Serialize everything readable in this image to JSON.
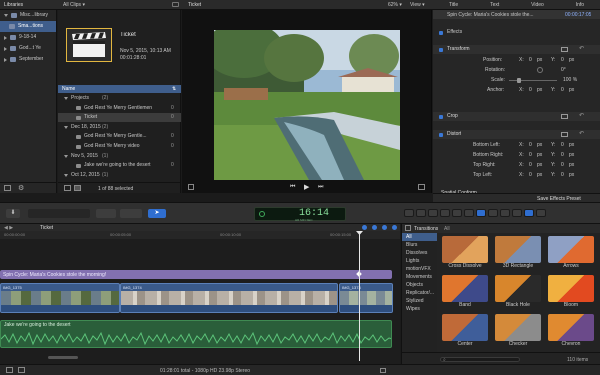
{
  "topbar": {
    "libraries": "Libraries",
    "all_clips": "All Clips ▾",
    "viewer_title": "Ticket",
    "zoom": "62% ▾",
    "view": "View ▾"
  },
  "library": {
    "items": [
      {
        "label": "Misc...library",
        "open": true,
        "sel": false
      },
      {
        "label": "Sma...tions",
        "open": false,
        "sel": true
      },
      {
        "label": "9-18-14",
        "open": false,
        "sel": false
      },
      {
        "label": "God...t Ye",
        "open": false,
        "sel": false
      },
      {
        "label": "September",
        "open": false,
        "sel": false
      }
    ]
  },
  "browser": {
    "clip_name": "Ticket",
    "clip_date": "Nov 5, 2015, 10:13 AM",
    "clip_duration": "00:01:28:01",
    "name_col": "Name",
    "rows": [
      {
        "indent": 1,
        "label": "Projects",
        "count": "(2)",
        "tri": "open",
        "sel": false
      },
      {
        "indent": 2,
        "label": "God Rest Ye Merry Gentlemen",
        "count": "0",
        "tri": "",
        "sel": false
      },
      {
        "indent": 2,
        "label": "Ticket",
        "count": "0",
        "tri": "",
        "sel": true
      },
      {
        "indent": 1,
        "label": "Dec 18, 2015",
        "count": "(2)",
        "tri": "open",
        "sel": false
      },
      {
        "indent": 2,
        "label": "God Rest Ye Merry Gentle...",
        "count": "0",
        "tri": "",
        "sel": false
      },
      {
        "indent": 2,
        "label": "God Rest Ye Merry video",
        "count": "0",
        "tri": "",
        "sel": false
      },
      {
        "indent": 1,
        "label": "Nov 5, 2015",
        "count": "(1)",
        "tri": "open",
        "sel": false
      },
      {
        "indent": 2,
        "label": "Jake we're going to the desert",
        "count": "0",
        "tri": "",
        "sel": false
      },
      {
        "indent": 1,
        "label": "Oct 12, 2015",
        "count": "(1)",
        "tri": "open",
        "sel": false
      }
    ],
    "selected_status": "1 of 88 selected"
  },
  "inspector": {
    "tabs": [
      "Title",
      "Text",
      "Video",
      "Info"
    ],
    "clip_title": "Spin Cycle: Maria's Cookies stole the...",
    "clip_time": "00:00:17:05",
    "effects_label": "Effects",
    "transform_label": "Transform",
    "position": {
      "label": "Position:",
      "x": "0",
      "y": "0",
      "unit": "px"
    },
    "rotation": {
      "label": "Rotation:",
      "value": "0°"
    },
    "scale": {
      "label": "Scale:",
      "value": "100 %"
    },
    "anchor": {
      "label": "Anchor:",
      "x": "0",
      "y": "0",
      "unit": "px"
    },
    "crop_label": "Crop",
    "distort_label": "Distort",
    "distort_rows": [
      {
        "label": "Bottom Left:",
        "x": "0",
        "y": "0"
      },
      {
        "label": "Bottom Right:",
        "x": "0",
        "y": "0"
      },
      {
        "label": "Top Right:",
        "x": "0",
        "y": "0"
      },
      {
        "label": "Top Left:",
        "x": "0",
        "y": "0"
      }
    ],
    "spatial_label": "Spatial Conform",
    "save_preset": "Save Effects Preset"
  },
  "toolbar": {
    "timecode": "16:14",
    "timecode_hms": "HR   MIN   SEC"
  },
  "timeline": {
    "title": "Ticket",
    "ruler": [
      "00:00:00:00",
      "00:00:05:00",
      "00:00:10:00",
      "00:00:15:00"
    ],
    "title_clip": "Spin Cycle: Maria's Cookies stole the morning!",
    "video1": "IMG_1375",
    "video2": "IMG_1374",
    "video3": "IMG_1373",
    "audio": "Jake we're going to the desert"
  },
  "transitions": {
    "header": "Transitions",
    "filter": "All",
    "categories": [
      "All",
      "Blurs",
      "Dissolves",
      "Lights",
      "motionVFX",
      "Movements",
      "Objects",
      "Replicator/...",
      "Stylized",
      "Wipes"
    ],
    "tiles": [
      "Cross Dissolve",
      "3D Rectangle",
      "Arrows",
      "Band",
      "Black Hole",
      "Bloom",
      "Center",
      "Checker",
      "Chevron"
    ],
    "count": "110 items"
  },
  "status": {
    "summary": "01:28:01 total - 1080p HD 23.98p Stereo"
  }
}
